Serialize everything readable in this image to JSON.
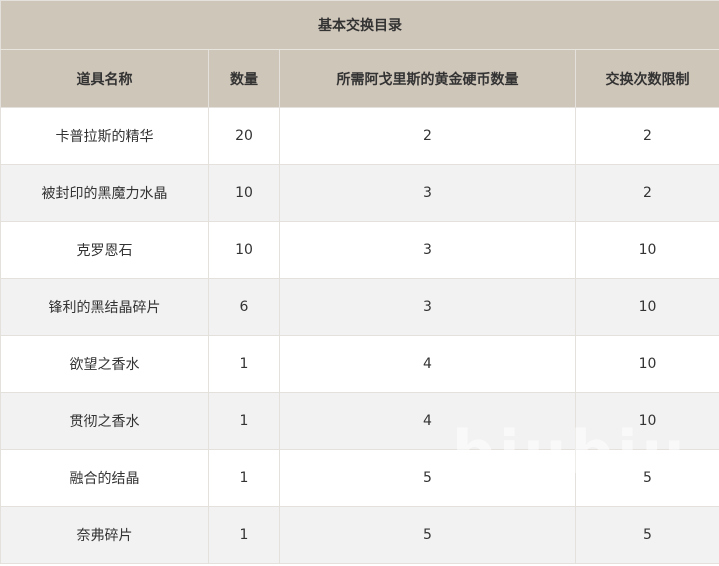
{
  "table": {
    "caption": "基本交换目录",
    "headers": [
      "道具名称",
      "数量",
      "所需阿戈里斯的黄金硬币数量",
      "交换次数限制"
    ],
    "rows": [
      [
        "卡普拉斯的精华",
        "20",
        "2",
        "2"
      ],
      [
        "被封印的黑魔力水晶",
        "10",
        "3",
        "2"
      ],
      [
        "克罗恩石",
        "10",
        "3",
        "10"
      ],
      [
        "锋利的黑结晶碎片",
        "6",
        "3",
        "10"
      ],
      [
        "欲望之香水",
        "1",
        "4",
        "10"
      ],
      [
        "贯彻之香水",
        "1",
        "4",
        "10"
      ],
      [
        "融合的结晶",
        "1",
        "5",
        "5"
      ],
      [
        "奈弗碎片",
        "1",
        "5",
        "5"
      ]
    ]
  },
  "watermark": "biubiu"
}
